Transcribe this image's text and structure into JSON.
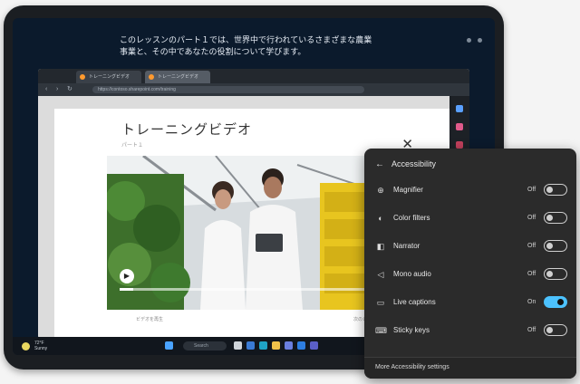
{
  "caption": {
    "line1": "このレッスンのパート１では、世界中で行われているさまざまな農業",
    "line2": "事業と、その中であなたの役割について学びます。"
  },
  "browser": {
    "tabs": [
      {
        "label": "トレーニングビデオ"
      },
      {
        "label": "トレーニングビデオ"
      }
    ],
    "url": "https://contoso.sharepoint.com/training",
    "edge_icons": [
      "copilot-icon",
      "shopping-icon",
      "tools-icon",
      "office-icon",
      "outlook-icon",
      "add-icon"
    ]
  },
  "page": {
    "title": "トレーニングビデオ",
    "subtitle": "パート１",
    "close_symbol": "✕",
    "left_caption": "ビデオを再生",
    "right_caption": "次のレッスン"
  },
  "video": {
    "play_symbol": "▶",
    "progress": 0.05
  },
  "taskbar": {
    "weather_label": "72°F",
    "weather_sub": "Sunny",
    "search_placeholder": "Search",
    "icons": [
      "start-icon",
      "search-icon",
      "task-view-icon",
      "widgets-icon",
      "edge-icon",
      "explorer-icon",
      "store-icon",
      "mail-icon",
      "teams-icon"
    ]
  },
  "accessibility": {
    "header": "Accessibility",
    "back_symbol": "←",
    "items": [
      {
        "label": "Magnifier",
        "state": "Off",
        "on": false,
        "icon": "magnifier-icon",
        "glyph": "⊕"
      },
      {
        "label": "Color filters",
        "state": "Off",
        "on": false,
        "icon": "color-filters-icon",
        "glyph": "◐"
      },
      {
        "label": "Narrator",
        "state": "Off",
        "on": false,
        "icon": "narrator-icon",
        "glyph": "◧"
      },
      {
        "label": "Mono audio",
        "state": "Off",
        "on": false,
        "icon": "mono-audio-icon",
        "glyph": "◁"
      },
      {
        "label": "Live captions",
        "state": "On",
        "on": true,
        "icon": "live-captions-icon",
        "glyph": "▭"
      },
      {
        "label": "Sticky keys",
        "state": "Off",
        "on": false,
        "icon": "sticky-keys-icon",
        "glyph": "⌨"
      }
    ],
    "footer": "More Accessibility settings"
  },
  "colors": {
    "toggle_on": "#4cc2ff",
    "panel_bg": "#2b2b2b"
  }
}
